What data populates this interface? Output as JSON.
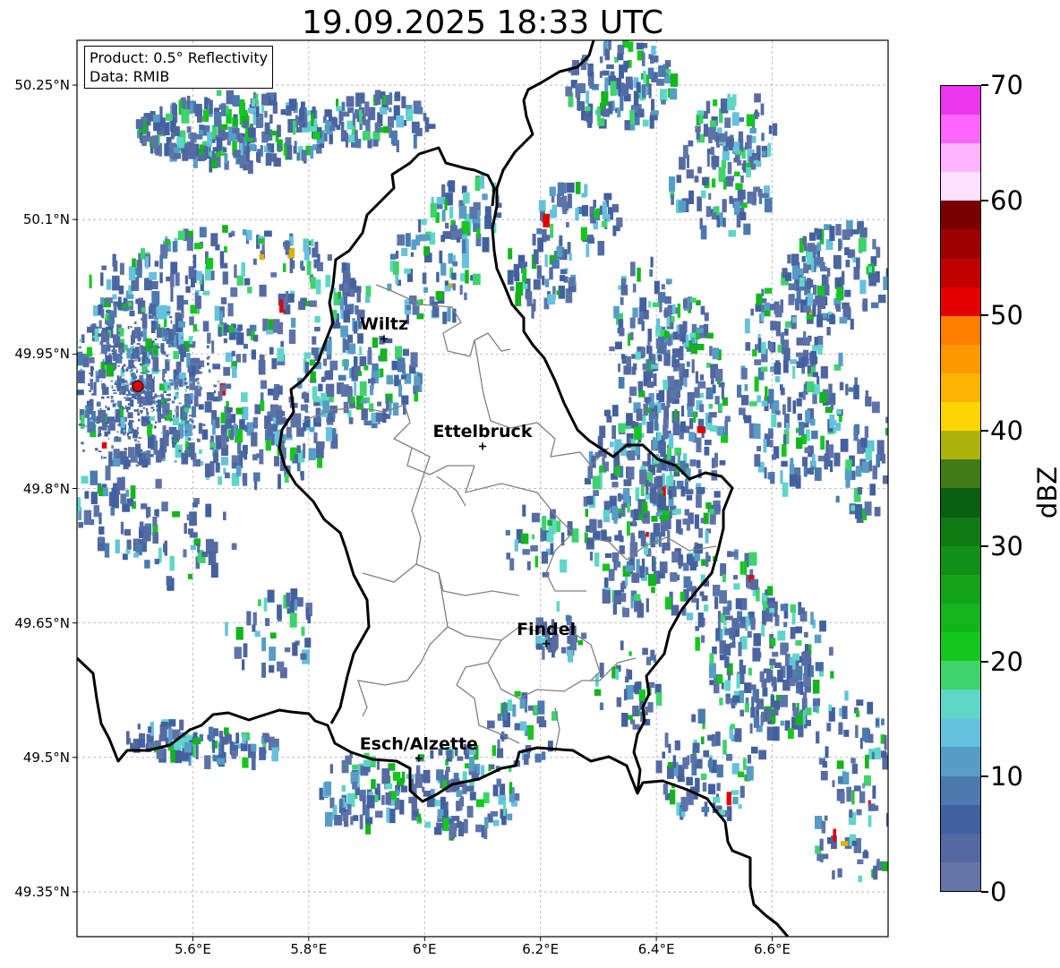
{
  "title": "19.09.2025 18:33 UTC",
  "info": {
    "product": "Product: 0.5° Reflectivity",
    "source": "Data: RMIB"
  },
  "axes": {
    "y_ticks": [
      {
        "value": 50.25,
        "label": "50.25°N"
      },
      {
        "value": 50.1,
        "label": "50.1°N"
      },
      {
        "value": 49.95,
        "label": "49.95°N"
      },
      {
        "value": 49.8,
        "label": "49.8°N"
      },
      {
        "value": 49.65,
        "label": "49.65°N"
      },
      {
        "value": 49.5,
        "label": "49.5°N"
      },
      {
        "value": 49.35,
        "label": "49.35°N"
      }
    ],
    "x_ticks": [
      {
        "value": 5.6,
        "label": "5.6°E"
      },
      {
        "value": 5.8,
        "label": "5.8°E"
      },
      {
        "value": 6.0,
        "label": "6°E"
      },
      {
        "value": 6.2,
        "label": "6.2°E"
      },
      {
        "value": 6.4,
        "label": "6.4°E"
      },
      {
        "value": 6.6,
        "label": "6.6°E"
      }
    ],
    "lon_range": [
      5.4,
      6.8
    ],
    "lat_range": [
      49.3,
      50.3
    ],
    "grid": true
  },
  "cities": [
    {
      "name": "Wiltz",
      "lon": 5.93,
      "lat": 49.967
    },
    {
      "name": "Ettelbruck",
      "lon": 6.1,
      "lat": 49.847
    },
    {
      "name": "Findel",
      "lon": 6.21,
      "lat": 49.627
    },
    {
      "name": "Esch/Alzette",
      "lon": 5.99,
      "lat": 49.499
    }
  ],
  "radar_site": {
    "lon": 5.505,
    "lat": 49.914
  },
  "colorbar": {
    "unit": "dBZ",
    "ticks": [
      {
        "value": 0,
        "label": "0"
      },
      {
        "value": 10,
        "label": "10"
      },
      {
        "value": 20,
        "label": "20"
      },
      {
        "value": 30,
        "label": "30"
      },
      {
        "value": 40,
        "label": "40"
      },
      {
        "value": 50,
        "label": "50"
      },
      {
        "value": 60,
        "label": "60"
      },
      {
        "value": 70,
        "label": "70"
      }
    ],
    "range": [
      0,
      70
    ],
    "step": 2.5,
    "colors": [
      "#6575a8",
      "#5468a2",
      "#42609f",
      "#4a7aaf",
      "#569dc7",
      "#65c1dd",
      "#5ed6c8",
      "#3ed36b",
      "#14c71e",
      "#12b51c",
      "#13a318",
      "#128f16",
      "#0f7b12",
      "#0a6010",
      "#417a16",
      "#adb30c",
      "#fdd500",
      "#fdb301",
      "#fd9800",
      "#fe7e00",
      "#e50000",
      "#c10000",
      "#9e0000",
      "#7a0000",
      "#ffe0ff",
      "#ffb3ff",
      "#ff66ff",
      "#ec36ec"
    ]
  },
  "echo_palette": {
    "weak": [
      "#566ba3",
      "#5d74a9",
      "#4c669f",
      "#42609f"
    ],
    "moderate": [
      "#4a7aaf",
      "#569dc7",
      "#65c1dd",
      "#5ed6c8"
    ],
    "strong": [
      "#3ed36b",
      "#14c71e",
      "#12b51c"
    ],
    "rare": [
      "#d8b300",
      "#e50000"
    ]
  },
  "colors": {
    "national_border": "#000000",
    "canton_border": "#808080",
    "grid": "#b0b0b0",
    "radar_marker": "#e00000"
  }
}
